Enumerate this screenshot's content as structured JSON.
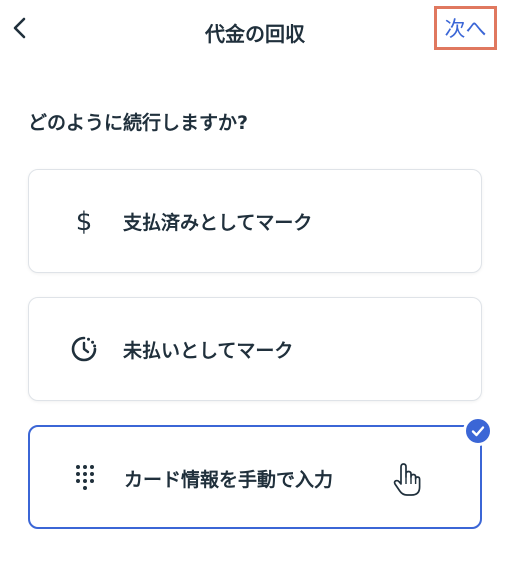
{
  "header": {
    "back_icon": "chevron-left-icon",
    "title": "代金の回収",
    "next_label": "次へ"
  },
  "question": "どのように続行しますか?",
  "options": [
    {
      "label": "支払済みとしてマーク",
      "icon": "dollar-icon",
      "selected": false
    },
    {
      "label": "未払いとしてマーク",
      "icon": "clock-pending-icon",
      "selected": false
    },
    {
      "label": "カード情報を手動で入力",
      "icon": "keypad-icon",
      "selected": true
    }
  ],
  "colors": {
    "accent": "#3b66d6",
    "highlight_box": "#e0785f",
    "text": "#20303c",
    "card_border": "#dfe3e8"
  }
}
